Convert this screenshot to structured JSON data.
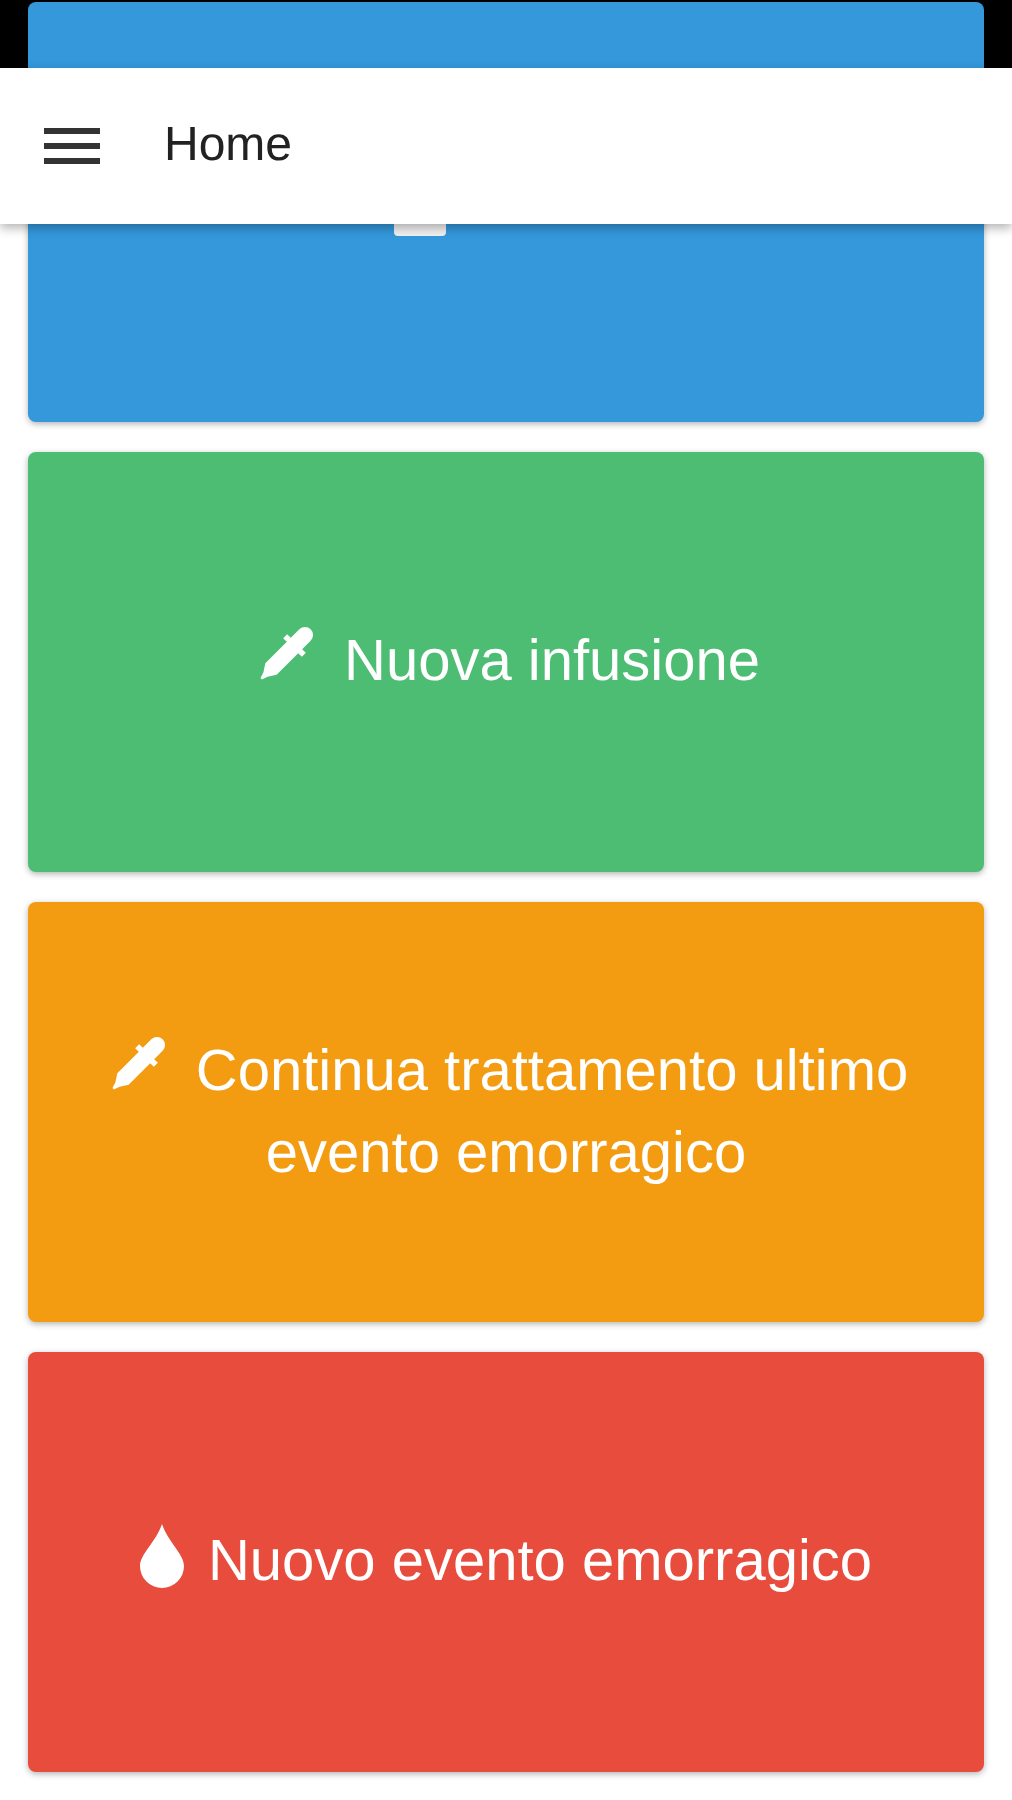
{
  "header": {
    "title": "Home"
  },
  "cards": [
    {
      "kind": "calendar",
      "color": "#3498db"
    },
    {
      "kind": "infusion",
      "label": "Nuova infusione",
      "color": "#4dbd74"
    },
    {
      "kind": "infusion",
      "label": "Continua trattamento ultimo evento emorragico",
      "color": "#f39c12"
    },
    {
      "kind": "bleed",
      "label": "Nuovo evento emorragico",
      "color": "#e74c3c"
    }
  ]
}
